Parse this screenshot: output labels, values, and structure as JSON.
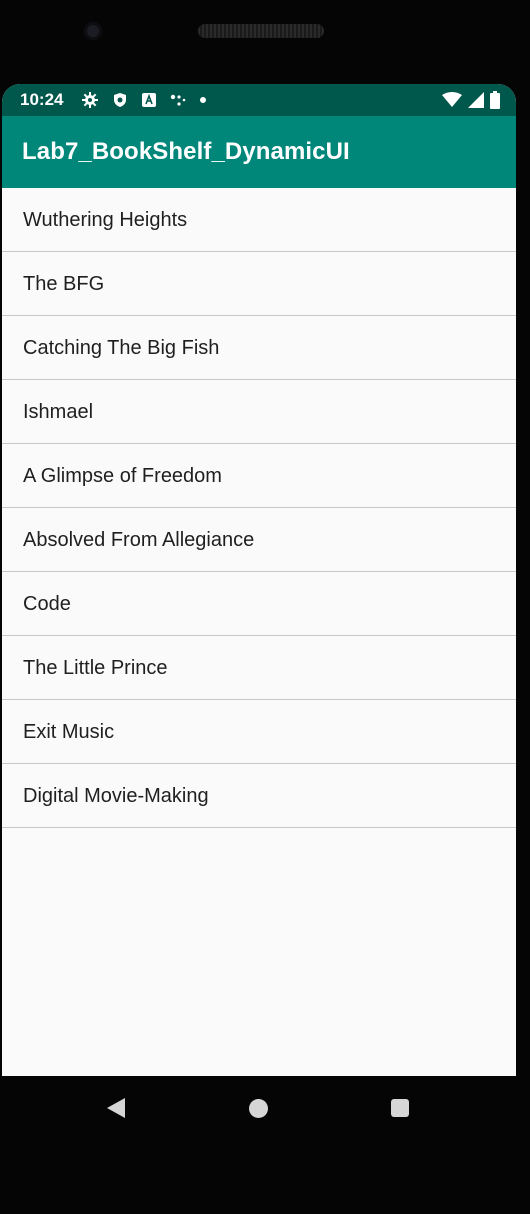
{
  "status_bar": {
    "time": "10:24",
    "icons_left": [
      "gear-icon",
      "shield-icon",
      "a-badge-icon",
      "signal-dots-icon",
      "dot-icon"
    ],
    "icons_right": [
      "wifi-icon",
      "cell-signal-icon",
      "battery-icon"
    ]
  },
  "app_bar": {
    "title": "Lab7_BookShelf_DynamicUI",
    "color": "#00877a",
    "status_color": "#00574b"
  },
  "books": [
    {
      "title": "Wuthering Heights"
    },
    {
      "title": "The BFG"
    },
    {
      "title": "Catching The Big Fish"
    },
    {
      "title": "Ishmael"
    },
    {
      "title": "A Glimpse of Freedom"
    },
    {
      "title": "Absolved From Allegiance"
    },
    {
      "title": "Code"
    },
    {
      "title": "The Little Prince"
    },
    {
      "title": "Exit Music"
    },
    {
      "title": "Digital Movie-Making"
    }
  ],
  "nav_bar": {
    "buttons": [
      "back-icon",
      "home-icon",
      "recents-icon"
    ]
  }
}
